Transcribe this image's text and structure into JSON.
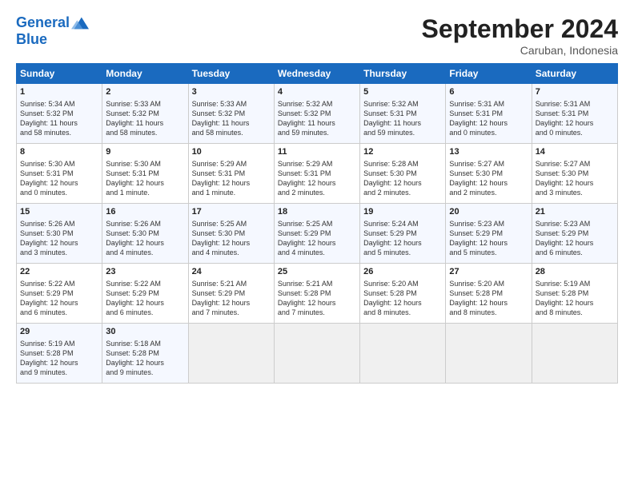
{
  "header": {
    "logo_line1": "General",
    "logo_line2": "Blue",
    "month": "September 2024",
    "location": "Caruban, Indonesia"
  },
  "weekdays": [
    "Sunday",
    "Monday",
    "Tuesday",
    "Wednesday",
    "Thursday",
    "Friday",
    "Saturday"
  ],
  "weeks": [
    [
      {
        "day": "1",
        "lines": [
          "Sunrise: 5:34 AM",
          "Sunset: 5:32 PM",
          "Daylight: 11 hours",
          "and 58 minutes."
        ]
      },
      {
        "day": "2",
        "lines": [
          "Sunrise: 5:33 AM",
          "Sunset: 5:32 PM",
          "Daylight: 11 hours",
          "and 58 minutes."
        ]
      },
      {
        "day": "3",
        "lines": [
          "Sunrise: 5:33 AM",
          "Sunset: 5:32 PM",
          "Daylight: 11 hours",
          "and 58 minutes."
        ]
      },
      {
        "day": "4",
        "lines": [
          "Sunrise: 5:32 AM",
          "Sunset: 5:32 PM",
          "Daylight: 11 hours",
          "and 59 minutes."
        ]
      },
      {
        "day": "5",
        "lines": [
          "Sunrise: 5:32 AM",
          "Sunset: 5:31 PM",
          "Daylight: 11 hours",
          "and 59 minutes."
        ]
      },
      {
        "day": "6",
        "lines": [
          "Sunrise: 5:31 AM",
          "Sunset: 5:31 PM",
          "Daylight: 12 hours",
          "and 0 minutes."
        ]
      },
      {
        "day": "7",
        "lines": [
          "Sunrise: 5:31 AM",
          "Sunset: 5:31 PM",
          "Daylight: 12 hours",
          "and 0 minutes."
        ]
      }
    ],
    [
      {
        "day": "8",
        "lines": [
          "Sunrise: 5:30 AM",
          "Sunset: 5:31 PM",
          "Daylight: 12 hours",
          "and 0 minutes."
        ]
      },
      {
        "day": "9",
        "lines": [
          "Sunrise: 5:30 AM",
          "Sunset: 5:31 PM",
          "Daylight: 12 hours",
          "and 1 minute."
        ]
      },
      {
        "day": "10",
        "lines": [
          "Sunrise: 5:29 AM",
          "Sunset: 5:31 PM",
          "Daylight: 12 hours",
          "and 1 minute."
        ]
      },
      {
        "day": "11",
        "lines": [
          "Sunrise: 5:29 AM",
          "Sunset: 5:31 PM",
          "Daylight: 12 hours",
          "and 2 minutes."
        ]
      },
      {
        "day": "12",
        "lines": [
          "Sunrise: 5:28 AM",
          "Sunset: 5:30 PM",
          "Daylight: 12 hours",
          "and 2 minutes."
        ]
      },
      {
        "day": "13",
        "lines": [
          "Sunrise: 5:27 AM",
          "Sunset: 5:30 PM",
          "Daylight: 12 hours",
          "and 2 minutes."
        ]
      },
      {
        "day": "14",
        "lines": [
          "Sunrise: 5:27 AM",
          "Sunset: 5:30 PM",
          "Daylight: 12 hours",
          "and 3 minutes."
        ]
      }
    ],
    [
      {
        "day": "15",
        "lines": [
          "Sunrise: 5:26 AM",
          "Sunset: 5:30 PM",
          "Daylight: 12 hours",
          "and 3 minutes."
        ]
      },
      {
        "day": "16",
        "lines": [
          "Sunrise: 5:26 AM",
          "Sunset: 5:30 PM",
          "Daylight: 12 hours",
          "and 4 minutes."
        ]
      },
      {
        "day": "17",
        "lines": [
          "Sunrise: 5:25 AM",
          "Sunset: 5:30 PM",
          "Daylight: 12 hours",
          "and 4 minutes."
        ]
      },
      {
        "day": "18",
        "lines": [
          "Sunrise: 5:25 AM",
          "Sunset: 5:29 PM",
          "Daylight: 12 hours",
          "and 4 minutes."
        ]
      },
      {
        "day": "19",
        "lines": [
          "Sunrise: 5:24 AM",
          "Sunset: 5:29 PM",
          "Daylight: 12 hours",
          "and 5 minutes."
        ]
      },
      {
        "day": "20",
        "lines": [
          "Sunrise: 5:23 AM",
          "Sunset: 5:29 PM",
          "Daylight: 12 hours",
          "and 5 minutes."
        ]
      },
      {
        "day": "21",
        "lines": [
          "Sunrise: 5:23 AM",
          "Sunset: 5:29 PM",
          "Daylight: 12 hours",
          "and 6 minutes."
        ]
      }
    ],
    [
      {
        "day": "22",
        "lines": [
          "Sunrise: 5:22 AM",
          "Sunset: 5:29 PM",
          "Daylight: 12 hours",
          "and 6 minutes."
        ]
      },
      {
        "day": "23",
        "lines": [
          "Sunrise: 5:22 AM",
          "Sunset: 5:29 PM",
          "Daylight: 12 hours",
          "and 6 minutes."
        ]
      },
      {
        "day": "24",
        "lines": [
          "Sunrise: 5:21 AM",
          "Sunset: 5:29 PM",
          "Daylight: 12 hours",
          "and 7 minutes."
        ]
      },
      {
        "day": "25",
        "lines": [
          "Sunrise: 5:21 AM",
          "Sunset: 5:28 PM",
          "Daylight: 12 hours",
          "and 7 minutes."
        ]
      },
      {
        "day": "26",
        "lines": [
          "Sunrise: 5:20 AM",
          "Sunset: 5:28 PM",
          "Daylight: 12 hours",
          "and 8 minutes."
        ]
      },
      {
        "day": "27",
        "lines": [
          "Sunrise: 5:20 AM",
          "Sunset: 5:28 PM",
          "Daylight: 12 hours",
          "and 8 minutes."
        ]
      },
      {
        "day": "28",
        "lines": [
          "Sunrise: 5:19 AM",
          "Sunset: 5:28 PM",
          "Daylight: 12 hours",
          "and 8 minutes."
        ]
      }
    ],
    [
      {
        "day": "29",
        "lines": [
          "Sunrise: 5:19 AM",
          "Sunset: 5:28 PM",
          "Daylight: 12 hours",
          "and 9 minutes."
        ]
      },
      {
        "day": "30",
        "lines": [
          "Sunrise: 5:18 AM",
          "Sunset: 5:28 PM",
          "Daylight: 12 hours",
          "and 9 minutes."
        ]
      },
      {
        "day": "",
        "lines": []
      },
      {
        "day": "",
        "lines": []
      },
      {
        "day": "",
        "lines": []
      },
      {
        "day": "",
        "lines": []
      },
      {
        "day": "",
        "lines": []
      }
    ]
  ],
  "colors": {
    "header_bg": "#1a6abf",
    "header_text": "#ffffff",
    "odd_row": "#f5f8ff",
    "even_row": "#ffffff",
    "empty_cell": "#f0f0f0"
  }
}
